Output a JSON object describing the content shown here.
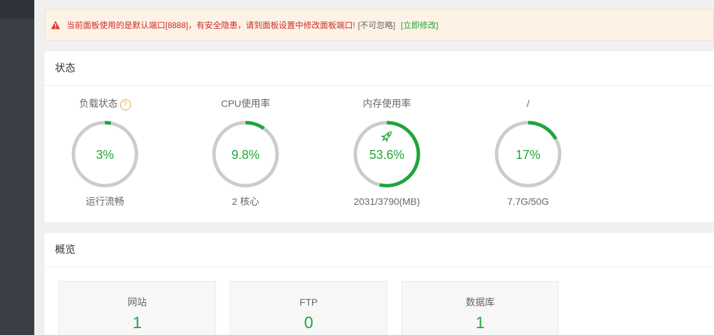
{
  "alert": {
    "message": "当前面板使用的是默认端口[8888]，有安全隐患，请到面板设置中修改面板端口!",
    "ignore_label": "[不可忽略]",
    "fix_label": "[立即修改]",
    "icon": "warning-triangle-icon",
    "colors": {
      "message": "#c9302c",
      "fix": "#20a53a"
    }
  },
  "status": {
    "title": "状态",
    "gauges": [
      {
        "title": "负载状态",
        "has_help": true,
        "value_text": "3%",
        "percent": 3,
        "sub": "运行流畅"
      },
      {
        "title": "CPU使用率",
        "has_help": false,
        "value_text": "9.8%",
        "percent": 9.8,
        "sub": "2 核心"
      },
      {
        "title": "内存使用率",
        "has_help": false,
        "value_text": "53.6%",
        "percent": 53.6,
        "sub": "2031/3790(MB)",
        "icon": "rocket-icon"
      },
      {
        "title": "/",
        "has_help": false,
        "value_text": "17%",
        "percent": 17,
        "sub": "7.7G/50G"
      }
    ],
    "help_glyph": "?",
    "colors": {
      "accent": "#20a53a",
      "track": "#cccccc"
    }
  },
  "overview": {
    "title": "概览",
    "cards": [
      {
        "label": "网站",
        "value": "1"
      },
      {
        "label": "FTP",
        "value": "0"
      },
      {
        "label": "数据库",
        "value": "1"
      }
    ]
  }
}
